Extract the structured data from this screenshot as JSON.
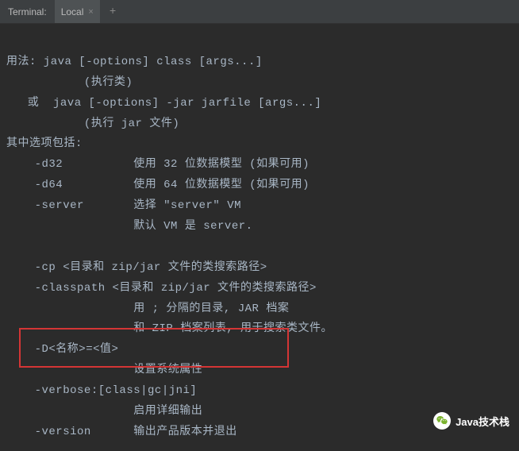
{
  "tabbar": {
    "panel_label": "Terminal:",
    "tab_name": "Local",
    "close_glyph": "×",
    "add_glyph": "+"
  },
  "terminal": {
    "lines": [
      "用法: java [-options] class [args...]",
      "           (执行类)",
      "   或  java [-options] -jar jarfile [args...]",
      "           (执行 jar 文件)",
      "其中选项包括:",
      "    -d32          使用 32 位数据模型 (如果可用)",
      "    -d64          使用 64 位数据模型 (如果可用)",
      "    -server       选择 \"server\" VM",
      "                  默认 VM 是 server.",
      "",
      "    -cp <目录和 zip/jar 文件的类搜索路径>",
      "    -classpath <目录和 zip/jar 文件的类搜索路径>",
      "                  用 ; 分隔的目录, JAR 档案",
      "                  和 ZIP 档案列表, 用于搜索类文件。",
      "    -D<名称>=<值>",
      "                  设置系统属性",
      "    -verbose:[class|gc|jni]",
      "                  启用详细输出",
      "    -version      输出产品版本并退出"
    ]
  },
  "watermark": {
    "text": "Java技术栈"
  }
}
